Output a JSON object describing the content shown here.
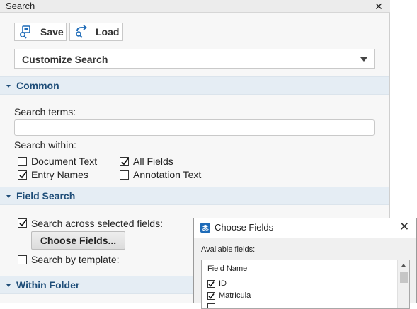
{
  "panel": {
    "title": "Search",
    "close_glyph": "✕",
    "toolbar": {
      "save_label": "Save",
      "load_label": "Load"
    },
    "customize_value": "Customize Search",
    "sections": {
      "common": "Common",
      "field_search": "Field Search",
      "within_folder": "Within Folder"
    },
    "common": {
      "search_terms_label": "Search terms:",
      "search_terms_value": "",
      "search_within_label": "Search within:",
      "options": [
        {
          "label": "Document Text",
          "checked": false
        },
        {
          "label": "All Fields",
          "checked": true
        },
        {
          "label": "Entry Names",
          "checked": true
        },
        {
          "label": "Annotation Text",
          "checked": false
        }
      ]
    },
    "field_search": {
      "across_label": "Search across selected fields:",
      "across_checked": true,
      "choose_button": "Choose Fields...",
      "template_label": "Search by template:",
      "template_checked": false
    }
  },
  "dialog": {
    "title": "Choose Fields",
    "close_glyph": "✕",
    "available_label": "Available fields:",
    "column_header": "Field Name",
    "fields": [
      {
        "name": "ID",
        "checked": true
      },
      {
        "name": "Matrícula",
        "checked": true
      },
      {
        "name": "",
        "checked": false
      }
    ]
  },
  "icons": {
    "save": "save-icon",
    "load": "load-icon",
    "dialog": "stack-icon"
  },
  "colors": {
    "section_bg": "#e5edf4",
    "section_text": "#1f4e79",
    "icon_blue": "#1e6bb8"
  }
}
